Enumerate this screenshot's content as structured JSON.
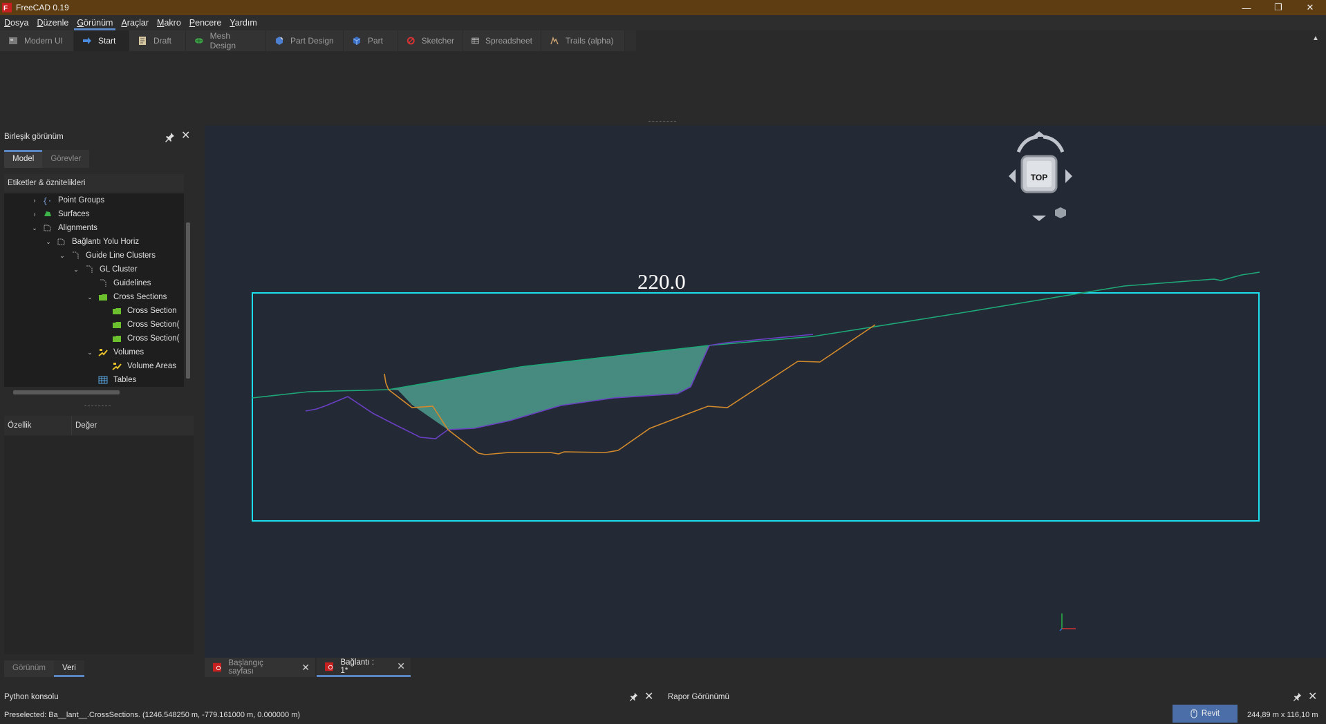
{
  "window": {
    "title": "FreeCAD 0.19",
    "minimize": "—",
    "maximize": "❐",
    "close": "✕"
  },
  "menu": [
    {
      "label": "Dosya",
      "u": "D",
      "rest": "osya"
    },
    {
      "label": "Düzenle",
      "u": "D",
      "rest": "üzenle"
    },
    {
      "label": "Görünüm",
      "u": "G",
      "rest": "örünüm",
      "active": true
    },
    {
      "label": "Araçlar",
      "u": "A",
      "rest": "raçlar"
    },
    {
      "label": "Makro",
      "u": "M",
      "rest": "akro"
    },
    {
      "label": "Pencere",
      "u": "P",
      "rest": "encere"
    },
    {
      "label": "Yardım",
      "u": "Y",
      "rest": "ardım"
    }
  ],
  "workbench_tabs": [
    {
      "label": "Modern UI",
      "icon": "modern-ui-icon"
    },
    {
      "label": "Start",
      "icon": "start-arrow-icon",
      "active": true
    },
    {
      "label": "Draft",
      "icon": "draft-icon"
    },
    {
      "label": "Mesh Design",
      "icon": "mesh-design-icon"
    },
    {
      "label": "Part Design",
      "icon": "part-design-icon"
    },
    {
      "label": "Part",
      "icon": "part-cube-icon"
    },
    {
      "label": "Sketcher",
      "icon": "sketcher-icon"
    },
    {
      "label": "Spreadsheet",
      "icon": "spreadsheet-icon"
    },
    {
      "label": "Trails (alpha)",
      "icon": "trails-icon"
    }
  ],
  "combo_view": {
    "title": "Birleşik görünüm",
    "tabs": [
      "Model",
      "Görevler"
    ],
    "tree_header": "Etiketler & öznitelikleri",
    "tree": [
      {
        "label": "Point Groups",
        "level": 0,
        "expander": "›",
        "icon": "point-groups-icon"
      },
      {
        "label": "Surfaces",
        "level": 0,
        "expander": "›",
        "icon": "surfaces-icon"
      },
      {
        "label": "Alignments",
        "level": 0,
        "expander": "⌄",
        "icon": "alignments-icon"
      },
      {
        "label": "Bağlantı Yolu Horiz",
        "level": 1,
        "expander": "⌄",
        "icon": "alignment-icon"
      },
      {
        "label": "Guide Line Clusters",
        "level": 2,
        "expander": "⌄",
        "icon": "guideline-clusters-icon"
      },
      {
        "label": "GL Cluster",
        "level": 3,
        "expander": "⌄",
        "icon": "gl-cluster-icon"
      },
      {
        "label": "Guidelines",
        "level": 4,
        "expander": "",
        "icon": "guidelines-icon"
      },
      {
        "label": "Cross Sections",
        "level": 4,
        "expander": "⌄",
        "icon": "folder-icon"
      },
      {
        "label": "Cross Section",
        "level": 5,
        "expander": "",
        "icon": "folder-icon"
      },
      {
        "label": "Cross Section(",
        "level": 5,
        "expander": "",
        "icon": "folder-icon"
      },
      {
        "label": "Cross Section(",
        "level": 5,
        "expander": "",
        "icon": "folder-icon"
      },
      {
        "label": "Volumes",
        "level": 4,
        "expander": "⌄",
        "icon": "volumes-icon"
      },
      {
        "label": "Volume Areas",
        "level": 5,
        "expander": "",
        "icon": "volumes-icon"
      },
      {
        "label": "Tables",
        "level": 4,
        "expander": "",
        "icon": "table-icon"
      }
    ],
    "prop_headers": [
      "Özellik",
      "Değer"
    ],
    "bottom_tabs": [
      "Görünüm",
      "Veri"
    ]
  },
  "viewport": {
    "annotation": "220.0",
    "navcube_label": "TOP",
    "colors": {
      "background": "#232a35",
      "frame": "#1ce0ee",
      "ground": "#1ea878",
      "design": "#6a3fc4",
      "existing": "#d38a2c",
      "fill": "#4a8f84"
    }
  },
  "document_tabs": [
    {
      "label": "Başlangıç sayfası",
      "close": "✕"
    },
    {
      "label": "Bağlantı : 1*",
      "close": "✕",
      "active": true
    }
  ],
  "panels": {
    "console": "Python konsolu",
    "report": "Rapor Görünümü"
  },
  "statusbar": {
    "preselected": "Preselected: Ba__lant__.CrossSections. (1246.548250 m, -779.161000 m, 0.000000 m)",
    "nav_style": "Revit",
    "dimensions": "244,89 m x 116,10 m"
  }
}
